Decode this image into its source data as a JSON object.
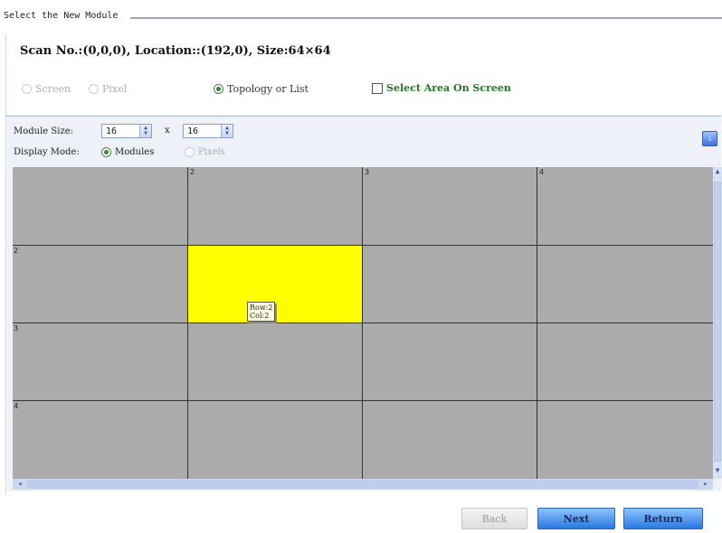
{
  "group": {
    "title": "Select the New Module"
  },
  "scan_info": "Scan No.:(0,0,0), Location::(192,0), Size:64×64",
  "options": {
    "screen": "Screen",
    "pixel": "Pixel",
    "topology": "Topology or List",
    "select_area": "Select Area On Screen"
  },
  "module_size": {
    "label": "Module Size:",
    "width": "16",
    "height": "16",
    "times": "x"
  },
  "display_mode": {
    "label": "Display Mode:",
    "modules": "Modules",
    "pixels": "Pixels"
  },
  "side_button_icon": "arrow-icon",
  "grid": {
    "col_labels": [
      "2",
      "3",
      "4"
    ],
    "row_labels": [
      "2",
      "3",
      "4"
    ],
    "tooltip": {
      "row": "Row:2",
      "col": "Col:2"
    },
    "colors": {
      "background": "#ababab",
      "selected": "#ffff00"
    }
  },
  "buttons": {
    "back": "Back",
    "next": "Next",
    "return": "Return"
  }
}
